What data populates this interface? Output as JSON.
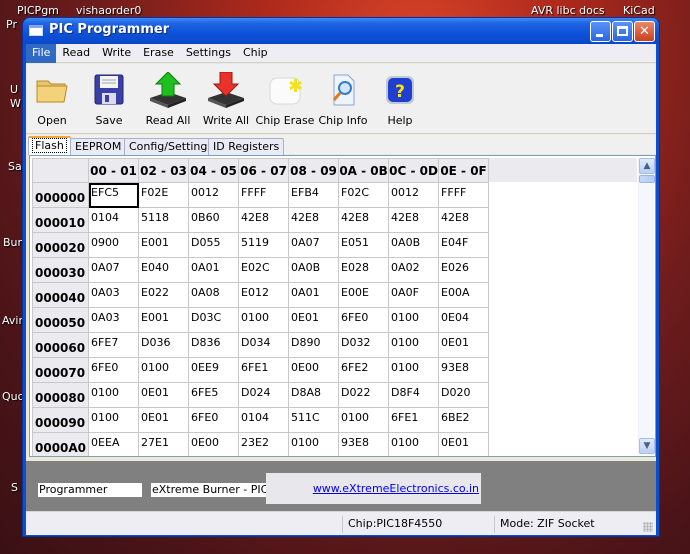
{
  "desktop": {
    "icons": [
      {
        "label": "PICPgm"
      },
      {
        "label": "vishaorder0"
      },
      {
        "label": "AVR libc docs"
      },
      {
        "label": "KiCad"
      },
      {
        "label": "Pr"
      },
      {
        "label": "U"
      },
      {
        "label": "W"
      },
      {
        "label": "Sa"
      },
      {
        "label": "Bur"
      },
      {
        "label": "Avir"
      },
      {
        "label": "Quo"
      },
      {
        "label": "S"
      }
    ]
  },
  "window": {
    "title": "PIC Programmer",
    "controls": {
      "minimize": "minimize",
      "maximize": "maximize",
      "close": "close"
    }
  },
  "menu": {
    "items": [
      {
        "label": "File",
        "active": true
      },
      {
        "label": "Read"
      },
      {
        "label": "Write"
      },
      {
        "label": "Erase"
      },
      {
        "label": "Settings"
      },
      {
        "label": "Chip"
      }
    ]
  },
  "toolbar": {
    "buttons": [
      {
        "label": "Open",
        "icon": "folder-icon"
      },
      {
        "label": "Save",
        "icon": "floppy-disk-icon"
      },
      {
        "label": "Read All",
        "icon": "chip-read-icon"
      },
      {
        "label": "Write All",
        "icon": "chip-write-icon"
      },
      {
        "label": "Chip Erase",
        "icon": "erase-icon"
      },
      {
        "label": "Chip Info",
        "icon": "magnifier-document-icon"
      },
      {
        "label": "Help",
        "icon": "help-icon"
      }
    ]
  },
  "tabs": [
    {
      "label": "Flash",
      "active": true
    },
    {
      "label": "EEPROM"
    },
    {
      "label": "Config/Settings"
    },
    {
      "label": "ID Registers"
    }
  ],
  "grid": {
    "columns": [
      "00 - 01",
      "02 - 03",
      "04 - 05",
      "06 - 07",
      "08 - 09",
      "0A - 0B",
      "0C - 0D",
      "0E - 0F"
    ],
    "rows": [
      {
        "address": "000000",
        "cells": [
          "EFC5",
          "F02E",
          "0012",
          "FFFF",
          "EFB4",
          "F02C",
          "0012",
          "FFFF"
        ]
      },
      {
        "address": "000010",
        "cells": [
          "0104",
          "5118",
          "0B60",
          "42E8",
          "42E8",
          "42E8",
          "42E8",
          "42E8"
        ]
      },
      {
        "address": "000020",
        "cells": [
          "0900",
          "E001",
          "D055",
          "5119",
          "0A07",
          "E051",
          "0A0B",
          "E04F"
        ]
      },
      {
        "address": "000030",
        "cells": [
          "0A07",
          "E040",
          "0A01",
          "E02C",
          "0A0B",
          "E028",
          "0A02",
          "E026"
        ]
      },
      {
        "address": "000040",
        "cells": [
          "0A03",
          "E022",
          "0A08",
          "E012",
          "0A01",
          "E00E",
          "0A0F",
          "E00A"
        ]
      },
      {
        "address": "000050",
        "cells": [
          "0A03",
          "E001",
          "D03C",
          "0100",
          "0E01",
          "6FE0",
          "0100",
          "0E04"
        ]
      },
      {
        "address": "000060",
        "cells": [
          "6FE7",
          "D036",
          "D836",
          "D034",
          "D890",
          "D032",
          "0100",
          "0E01"
        ]
      },
      {
        "address": "000070",
        "cells": [
          "6FE0",
          "0100",
          "0EE9",
          "6FE1",
          "0E00",
          "6FE2",
          "0100",
          "93E8"
        ]
      },
      {
        "address": "000080",
        "cells": [
          "0100",
          "0E01",
          "6FE5",
          "D024",
          "D8A8",
          "D022",
          "D8F4",
          "D020"
        ]
      },
      {
        "address": "000090",
        "cells": [
          "0100",
          "0E01",
          "6FE0",
          "0104",
          "511C",
          "0100",
          "6FE1",
          "6BE2"
        ]
      },
      {
        "address": "0000A0",
        "cells": [
          "0EEA",
          "27E1",
          "0E00",
          "23E2",
          "0100",
          "93E8",
          "0100",
          "0E01"
        ]
      }
    ],
    "selected_cell": {
      "row": 0,
      "col": 0
    }
  },
  "footer": {
    "programmer_label": "Programmer",
    "product_name": "eXtreme Burner - PIC",
    "website": "www.eXtremeElectronics.co.in"
  },
  "statusbar": {
    "chip": "Chip:PIC18F4550",
    "mode": "Mode: ZIF Socket"
  }
}
